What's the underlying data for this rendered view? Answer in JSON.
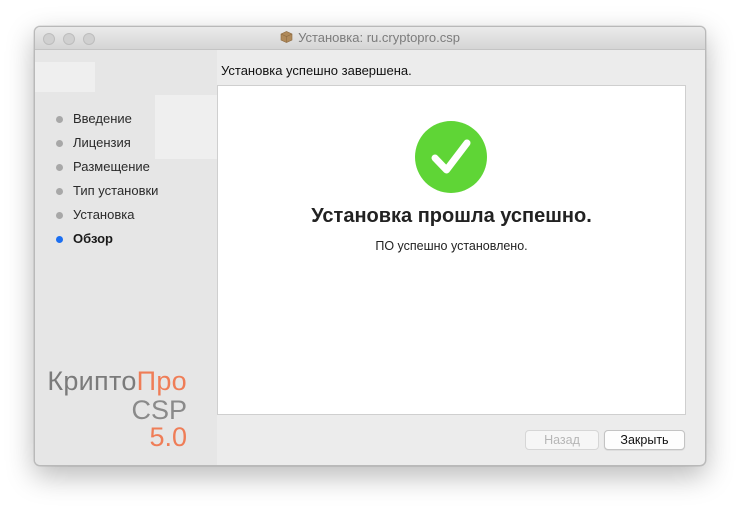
{
  "window": {
    "title": "Установка: ru.cryptopro.csp"
  },
  "sidebar": {
    "steps": [
      {
        "label": "Введение"
      },
      {
        "label": "Лицензия"
      },
      {
        "label": "Размещение"
      },
      {
        "label": "Тип установки"
      },
      {
        "label": "Установка"
      },
      {
        "label": "Обзор",
        "active": true
      }
    ],
    "logo": {
      "krypto": "Крипто",
      "pro": "Про",
      "csp": "CSP",
      "version": "5.0"
    }
  },
  "header": {
    "text": "Установка успешно завершена."
  },
  "main": {
    "title": "Установка прошла успешно.",
    "subtitle": "ПО успешно установлено."
  },
  "buttons": {
    "back": "Назад",
    "close": "Закрыть"
  },
  "colors": {
    "accent": "#1c6ff1",
    "success": "#5fd536",
    "logo_orange": "#ef7d57"
  }
}
